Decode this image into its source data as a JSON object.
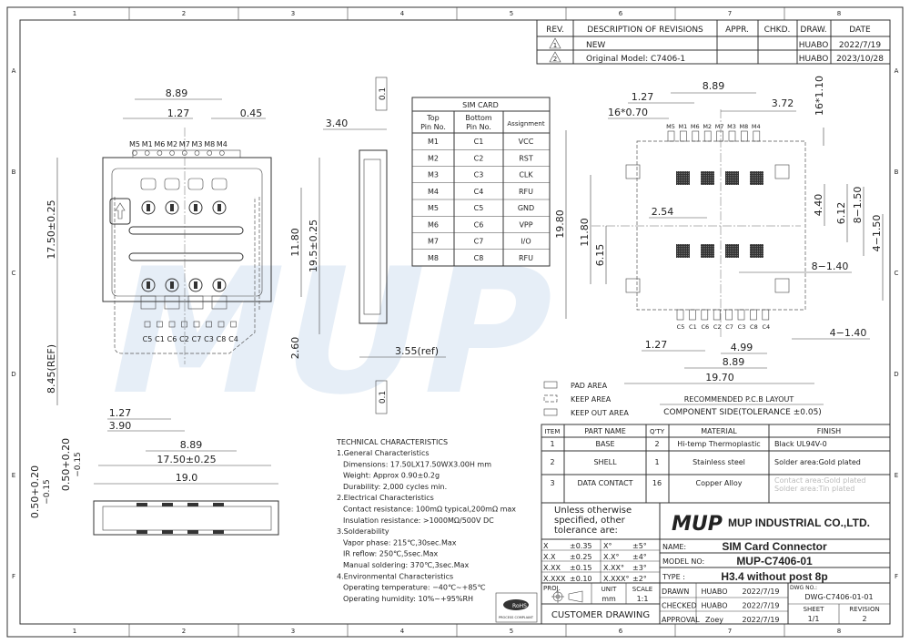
{
  "grid": {
    "columns": [
      "1",
      "2",
      "3",
      "4",
      "5",
      "6",
      "7",
      "8"
    ],
    "rows": [
      "A",
      "B",
      "C",
      "D",
      "E",
      "F"
    ]
  },
  "revisions": {
    "headers": [
      "REV.",
      "DESCRIPTION OF REVISIONS",
      "APPR.",
      "CHKD.",
      "DRAW.",
      "DATE"
    ],
    "rows": [
      {
        "rev": "1",
        "description": "NEW",
        "appr": "",
        "chkd": "",
        "draw": "HUABO",
        "date": "2022/7/19"
      },
      {
        "rev": "2",
        "description": "Original Model: C7406-1",
        "appr": "",
        "chkd": "",
        "draw": "HUABO",
        "date": "2023/10/28"
      }
    ]
  },
  "sim_table": {
    "title": "SIM CARD",
    "headers": [
      "Top\nPin No.",
      "Bottom\nPin No.",
      "Assignment"
    ],
    "h1a": "Top",
    "h1b": "Pin No.",
    "h2a": "Bottom",
    "h2b": "Pin No.",
    "h3": "Assignment",
    "rows": [
      [
        "M1",
        "C1",
        "VCC"
      ],
      [
        "M2",
        "C2",
        "RST"
      ],
      [
        "M3",
        "C3",
        "CLK"
      ],
      [
        "M4",
        "C4",
        "RFU"
      ],
      [
        "M5",
        "C5",
        "GND"
      ],
      [
        "M6",
        "C6",
        "VPP"
      ],
      [
        "M7",
        "C7",
        "I/O"
      ],
      [
        "M8",
        "C8",
        "RFU"
      ]
    ]
  },
  "top_view": {
    "dims": {
      "d889": "8.89",
      "d127": "1.27",
      "d045": "0.45",
      "d1750": "17.50±0.25",
      "d1180": "11.80",
      "d195": "19.5±0.25",
      "d260": "2.60",
      "d845": "8.45(REF)",
      "d127b": "1.27",
      "d390": "3.90",
      "d889b": "8.89",
      "d1750w": "17.50±0.25",
      "d190": "19.0"
    },
    "top_pins": [
      "M5",
      "M1",
      "M6",
      "M2",
      "M7",
      "M3",
      "M8",
      "M4"
    ],
    "bottom_pins": [
      "C5",
      "C1",
      "C6",
      "C2",
      "C7",
      "C3",
      "C8",
      "C4"
    ]
  },
  "side_view": {
    "d340": "3.40",
    "d355": "3.55(ref)",
    "d01a": "0.1",
    "d01b": "0.1"
  },
  "front_view": {
    "d050a": "0.50+0.20",
    "d050a2": "−0.15",
    "d050b": "0.50+0.20",
    "d050b2": "−0.15"
  },
  "pcb": {
    "dims": {
      "d889": "8.89",
      "d127": "1.27",
      "d070": "16*0.70",
      "d372": "3.72",
      "d110": "16*1.10",
      "d1980": "19.80",
      "d1180": "11.80",
      "d615": "6.15",
      "d254": "2.54",
      "d440": "4.40",
      "d612": "6.12",
      "d8150": "8−1.50",
      "d4150": "4−1.50",
      "d8140": "8−1.40",
      "d4140": "4−1.40",
      "d127b": "1.27",
      "d499": "4.99",
      "d889b": "8.89",
      "d1970": "19.70"
    },
    "top_pins": [
      "M5",
      "M1",
      "M6",
      "M2",
      "M7",
      "M3",
      "M8",
      "M4"
    ],
    "bottom_pins": [
      "C5",
      "C1",
      "C6",
      "C2",
      "C7",
      "C3",
      "C8",
      "C4"
    ],
    "legend": [
      "PAD AREA",
      "KEEP AREA",
      "KEEP OUT AREA"
    ],
    "caption1": "RECOMMENDED P.C.B LAYOUT",
    "caption2": "COMPONENT SIDE(TOLERANCE ±0.05)"
  },
  "tech": {
    "title": "TECHNICAL CHARACTERISTICS",
    "lines": [
      "1.General Characteristics",
      "Dimensions: 17.50LX17.50WX3.00H  mm",
      "Weight: Approx  0.90±0.2g",
      "Durability: 2,000  cycles min.",
      "2.Electrical Characteristics",
      "Contact  resistance: 100mΩ  typical,200mΩ  max",
      "Insulation  resistance: >1000MΩ/500V  DC",
      "3.Solderability",
      "Vapor  phase: 215℃,30sec.Max",
      "IR  reflow: 250℃,5sec.Max",
      "Manual  soldering: 370℃,3sec.Max",
      "4.Environmental  Characteristics",
      "Operating  temperature: −40℃~+85℃",
      "Operating  humidity: 10%~+95%RH"
    ],
    "rohs": "RoHS",
    "rohs_sub": "PROCESS COMPLIANT"
  },
  "parts": {
    "headers": [
      "ITEM",
      "PART NAME",
      "Q'TY",
      "MATERIAL",
      "FINISH"
    ],
    "rows": [
      {
        "item": "1",
        "name": "BASE",
        "qty": "2",
        "material": "Hi-temp Thermoplastic",
        "finish": "Black UL94V-0",
        "finish2": ""
      },
      {
        "item": "2",
        "name": "SHELL",
        "qty": "1",
        "material": "Stainless steel",
        "finish": "Solder area:Gold plated",
        "finish2": ""
      },
      {
        "item": "3",
        "name": "DATA CONTACT",
        "qty": "16",
        "material": "Copper Alloy",
        "finish": "Contact area:Gold plated",
        "finish2": "Solder area:Tin plated"
      }
    ]
  },
  "title_block": {
    "tol_note": [
      "Unless otherwise",
      "specified, other",
      "tolerance are:"
    ],
    "tolerances": [
      [
        "X",
        "±0.35",
        "X°",
        "±5°"
      ],
      [
        "X.X",
        "±0.25",
        "X.X°",
        "±4°"
      ],
      [
        "X.XX",
        "±0.15",
        "X.XX°",
        "±3°"
      ],
      [
        "X.XXX",
        "±0.10",
        "X.XXX°",
        "±2°"
      ]
    ],
    "proj_label": "PROJ.",
    "unit_label": "UNIT",
    "unit": "mm",
    "scale_label": "SCALE",
    "scale": "1:1",
    "customer_drawing": "CUSTOMER  DRAWING",
    "logo": "MUP",
    "company": "MUP INDUSTRIAL CO.,LTD.",
    "name_label": "NAME:",
    "name": "SIM Card Connector",
    "model_label": "MODEL NO:",
    "model": "MUP-C7406-01",
    "type_label": "TYPE :",
    "type": "H3.4 without post 8p",
    "signoffs": [
      {
        "role": "DRAWN",
        "who": "HUABO",
        "date": "2022/7/19"
      },
      {
        "role": "CHECKED",
        "who": "HUABO",
        "date": "2022/7/19"
      },
      {
        "role": "APPROVAL",
        "who": "Zoey",
        "date": "2022/7/19"
      }
    ],
    "dwg_label": "DWG NO.:",
    "dwg": "DWG-C7406-01-01",
    "sheet_label": "SHEET",
    "sheet": "1/1",
    "revision_label": "REVISION",
    "revision": "2"
  },
  "watermark": "MUP"
}
